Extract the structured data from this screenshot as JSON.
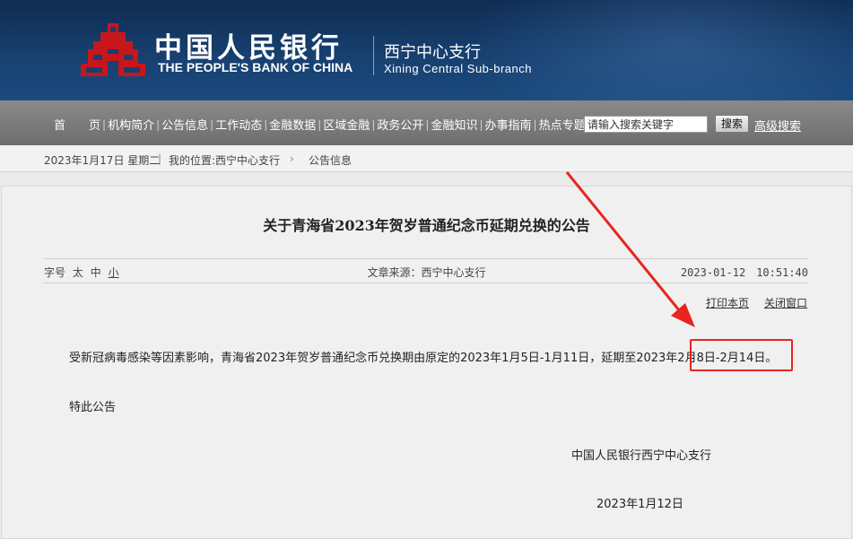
{
  "brand": {
    "name_cn": "中国人民银行",
    "name_en": "THE PEOPLE'S BANK OF CHINA",
    "branch_cn": "西宁中心支行",
    "branch_en": "Xining Central Sub-branch",
    "colors": {
      "header": "#17406f",
      "logo_red": "#c8161d",
      "nav": "#7a7a7a",
      "annotation": "#e8251f"
    }
  },
  "nav": {
    "items": [
      "首　　页",
      "机构简介",
      "公告信息",
      "工作动态",
      "金融数据",
      "区域金融",
      "政务公开",
      "金融知识",
      "办事指南",
      "热点专题"
    ],
    "search_placeholder": "请输入搜索关键字",
    "search_button": "搜索",
    "advanced_search": "高级搜索"
  },
  "breadcrumb": {
    "date": "2023年1月17日 星期二",
    "location_label": "我的位置:西宁中心支行",
    "current": "公告信息"
  },
  "article": {
    "title": "关于青海省2023年贺岁普通纪念币延期兑换的公告",
    "font_size_label": "字号",
    "font_sizes": [
      "太",
      "中",
      "小"
    ],
    "source": "文章来源：西宁中心支行",
    "datetime": "2023-01-12　10:51:40",
    "print_label": "打印本页",
    "close_label": "关闭窗口",
    "body": "受新冠病毒感染等因素影响，青海省2023年贺岁普通纪念币兑换期由原定的2023年1月5日-1月11日，延期至2023年2月8日-2月14日。",
    "special_notice": "特此公告",
    "signature": "中国人民银行西宁中心支行",
    "sign_date": "2023年1月12日"
  }
}
